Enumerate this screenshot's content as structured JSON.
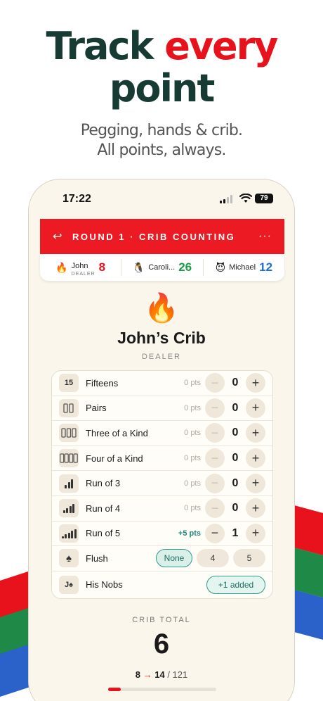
{
  "hero": {
    "line1_a": "Track",
    "line1_b": "every",
    "line2": "point",
    "sub1": "Pegging, hands & crib.",
    "sub2": "All points, always."
  },
  "status": {
    "time": "17:22",
    "battery": "79"
  },
  "topbar": {
    "back": "↩",
    "title": "ROUND 1 · CRIB COUNTING",
    "more": "···"
  },
  "players": [
    {
      "emoji": "🔥",
      "name": "John",
      "role": "DEALER",
      "score": "8",
      "color": "#e8121c"
    },
    {
      "emoji": "🐧",
      "name": "Caroli...",
      "role": "",
      "score": "26",
      "color": "#1a9e45"
    },
    {
      "emoji": "😈",
      "name": "Michael",
      "role": "",
      "score": "12",
      "color": "#1d6fd6"
    }
  ],
  "crib": {
    "emoji": "🔥",
    "title": "John’s Crib",
    "role": "DEALER"
  },
  "rows": [
    {
      "icon": "15",
      "label": "Fifteens",
      "pts": "0 pts",
      "value": "0",
      "active": false
    },
    {
      "icon": "pairs",
      "label": "Pairs",
      "pts": "0 pts",
      "value": "0",
      "active": false
    },
    {
      "icon": "three",
      "label": "Three of a Kind",
      "pts": "0 pts",
      "value": "0",
      "active": false
    },
    {
      "icon": "four",
      "label": "Four of a Kind",
      "pts": "0 pts",
      "value": "0",
      "active": false
    },
    {
      "icon": "run3",
      "label": "Run of 3",
      "pts": "0 pts",
      "value": "0",
      "active": false
    },
    {
      "icon": "run4",
      "label": "Run of 4",
      "pts": "0 pts",
      "value": "0",
      "active": false
    },
    {
      "icon": "run5",
      "label": "Run of 5",
      "pts": "+5 pts",
      "value": "1",
      "active": true
    }
  ],
  "flush": {
    "icon": "♠",
    "label": "Flush",
    "options": [
      "None",
      "4",
      "5"
    ],
    "selected": "None"
  },
  "nobs": {
    "icon": "J♠",
    "label": "His Nobs",
    "button": "+1 added"
  },
  "total": {
    "label": "CRIB TOTAL",
    "value": "6",
    "from": "8",
    "to": "14",
    "goal": "/ 121",
    "progress": 0.116
  },
  "colors": {
    "red": "#e8121c",
    "dark": "#173b33",
    "teal": "#1c6f63"
  }
}
